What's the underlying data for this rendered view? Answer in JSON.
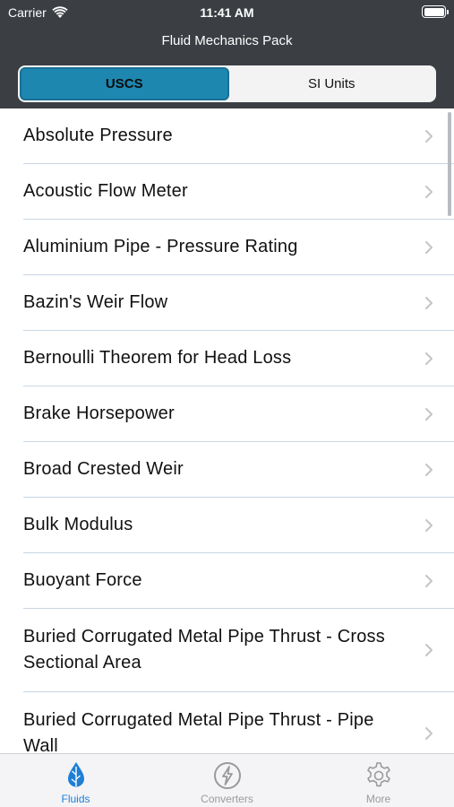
{
  "status_bar": {
    "carrier": "Carrier",
    "time": "11:41 AM"
  },
  "header": {
    "title": "Fluid Mechanics Pack"
  },
  "segmented": {
    "options": [
      "USCS",
      "SI Units"
    ],
    "selected": "USCS"
  },
  "list": {
    "items": [
      {
        "label": "Absolute Pressure"
      },
      {
        "label": "Acoustic Flow Meter"
      },
      {
        "label": "Aluminium Pipe - Pressure Rating"
      },
      {
        "label": "Bazin's Weir Flow"
      },
      {
        "label": "Bernoulli Theorem for Head Loss"
      },
      {
        "label": "Brake Horsepower"
      },
      {
        "label": "Broad Crested Weir"
      },
      {
        "label": "Bulk Modulus"
      },
      {
        "label": "Buoyant Force"
      },
      {
        "label": "Buried Corrugated Metal Pipe Thrust - Cross Sectional Area"
      },
      {
        "label": "Buried Corrugated Metal Pipe Thrust - Pipe Wall"
      }
    ]
  },
  "tab_bar": {
    "tabs": [
      {
        "label": "Fluids",
        "icon": "drop-icon",
        "active": true
      },
      {
        "label": "Converters",
        "icon": "bolt-icon",
        "active": false
      },
      {
        "label": "More",
        "icon": "gear-icon",
        "active": false
      }
    ]
  },
  "colors": {
    "header_bg": "#3b3f44",
    "segment_selected": "#1e87b0",
    "tab_active": "#1d7fd6",
    "tab_inactive": "#9a9a9e"
  }
}
